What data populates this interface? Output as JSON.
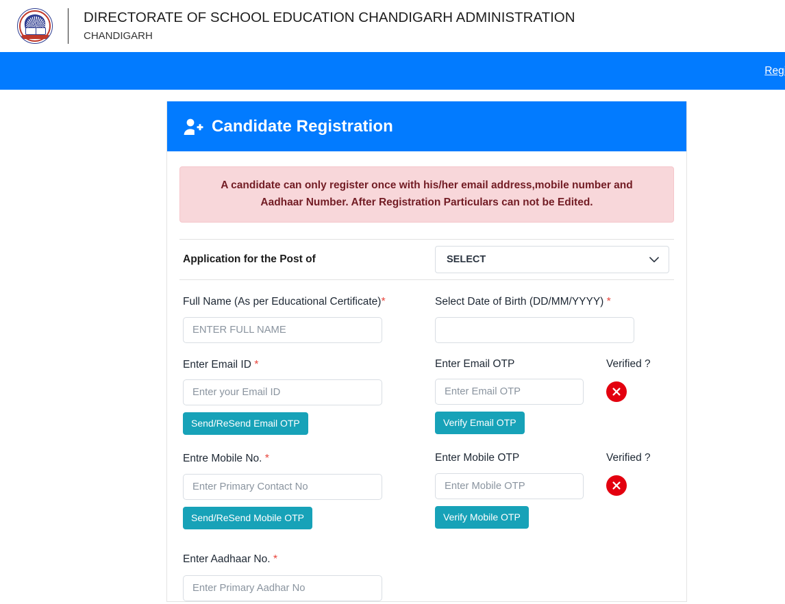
{
  "header": {
    "logo_icon": "department-emblem-icon",
    "logo_caption": "DIRECTORATE OF SCHOOL EDUCATION",
    "title": "DIRECTORATE OF SCHOOL EDUCATION CHANDIGARH ADMINISTRATION",
    "subtitle": "CHANDIGARH"
  },
  "navbar": {
    "background": "#027bff",
    "links": [
      {
        "label": "Registra"
      }
    ]
  },
  "card": {
    "header": {
      "icon": "user-plus-icon",
      "title": "Candidate Registration",
      "background": "#027bff"
    },
    "alert": {
      "line1": "A candidate can only register once with his/her email address,mobile number and",
      "line2": "Aadhaar Number. After Registration Particulars can not be Edited.",
      "text_color": "#721c24",
      "background": "#f8d7da"
    },
    "post_row": {
      "label": "Application for the Post of",
      "select_value": "SELECT",
      "chevron_icon": "chevron-down-icon"
    },
    "fields": {
      "full_name": {
        "label": "Full Name (As per Educational Certificate)",
        "required_mark": "*",
        "placeholder": "ENTER FULL NAME",
        "value": ""
      },
      "dob": {
        "label": "Select Date of Birth (DD/MM/YYYY)",
        "required_mark": "*",
        "placeholder": "",
        "value": ""
      },
      "email": {
        "label": "Enter Email ID",
        "required_mark": "*",
        "placeholder": "Enter your Email ID",
        "value": "",
        "send_button": "Send/ReSend Email OTP"
      },
      "email_otp": {
        "label": "Enter Email OTP",
        "placeholder": "Enter Email OTP",
        "value": "",
        "verify_button": "Verify Email OTP",
        "verified_label": "Verified ?",
        "verified_icon": "circle-x-icon",
        "verified_color": "#e3000f"
      },
      "mobile": {
        "label": "Entre Mobile No.",
        "required_mark": "*",
        "placeholder": "Enter Primary Contact No",
        "value": "",
        "send_button": "Send/ReSend Mobile OTP"
      },
      "mobile_otp": {
        "label": "Enter Mobile OTP",
        "placeholder": "Enter Mobile OTP",
        "value": "",
        "verify_button": "Verify Mobile OTP",
        "verified_label": "Verified ?",
        "verified_icon": "circle-x-icon",
        "verified_color": "#e3000f"
      },
      "aadhaar": {
        "label": "Enter Aadhaar No.",
        "required_mark": "*",
        "placeholder": "Enter Primary Aadhar No",
        "value": ""
      }
    }
  },
  "theme": {
    "primary_blue": "#027bff",
    "button_teal": "#17a2b8",
    "danger_red": "#e3000f"
  }
}
